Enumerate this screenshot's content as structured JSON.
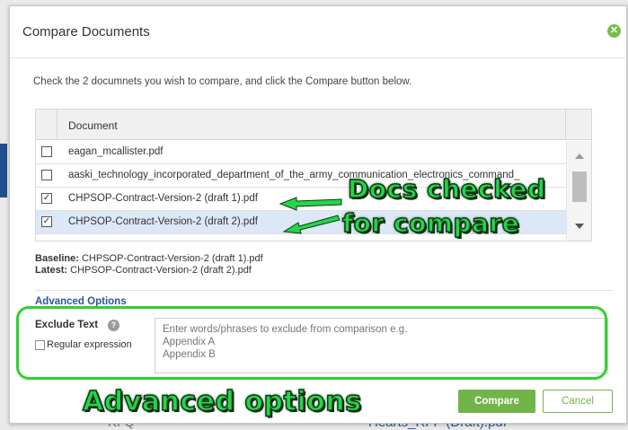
{
  "background": {
    "bottom_link": "Hearts_RFP (Draft).pdf",
    "bottom_left": "RFQ"
  },
  "dialog": {
    "title": "Compare Documents",
    "instructions": "Check the 2 documnets you wish to compare, and click the Compare button below.",
    "table": {
      "header": "Document",
      "rows": [
        {
          "name": "eagan_mcallister.pdf",
          "checked": false,
          "selected": false
        },
        {
          "name": "aaski_technology_incorporated_department_of_the_army_communication_electronics_command_",
          "checked": false,
          "selected": false
        },
        {
          "name": "CHPSOP-Contract-Version-2 (draft 1).pdf",
          "checked": true,
          "selected": false
        },
        {
          "name": "CHPSOP-Contract-Version-2 (draft 2).pdf",
          "checked": true,
          "selected": true
        }
      ]
    },
    "baseline_label": "Baseline:",
    "baseline_value": "CHPSOP-Contract-Version-2 (draft 1).pdf",
    "latest_label": "Latest:",
    "latest_value": "CHPSOP-Contract-Version-2 (draft 2).pdf",
    "advanced_title": "Advanced Options",
    "exclude_label": "Exclude Text",
    "regex_label": "Regular expression",
    "exclude_placeholder": "Enter words/phrases to exclude from comparison e.g.\nAppendix A\nAppendix B",
    "compare_label": "Compare",
    "cancel_label": "Cancel"
  },
  "annotations": {
    "docs_line1": "Docs checked",
    "docs_line2": "for compare",
    "advanced": "Advanced options"
  },
  "colors": {
    "accent_green": "#71b44a",
    "annotation_green": "#23d64a",
    "link_blue": "#2b5797",
    "selected_row": "#dce8f6"
  }
}
